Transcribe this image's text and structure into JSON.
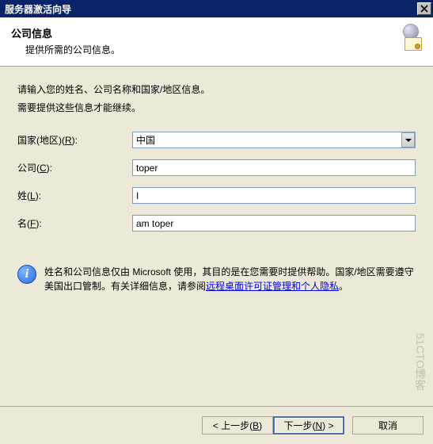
{
  "window": {
    "title": "服务器激活向导"
  },
  "header": {
    "title": "公司信息",
    "subtitle": "提供所需的公司信息。"
  },
  "intro": {
    "line1": "请输入您的姓名、公司名称和国家/地区信息。",
    "line2": "需要提供这些信息才能继续。"
  },
  "form": {
    "country": {
      "label_pre": "国家(地区)(",
      "label_key": "R",
      "label_post": "):",
      "value": "中国"
    },
    "company": {
      "label_pre": "公司(",
      "label_key": "C",
      "label_post": "):",
      "value": "toper"
    },
    "lastname": {
      "label_pre": "姓(",
      "label_key": "L",
      "label_post": "):",
      "value": "I"
    },
    "firstname": {
      "label_pre": "名(",
      "label_key": "F",
      "label_post": "):",
      "value": "am toper"
    }
  },
  "info": {
    "text_pre": "姓名和公司信息仅由 Microsoft 使用，其目的是在您需要时提供帮助。国家/地区需要遵守美国出口管制。有关详细信息，请参阅",
    "link": "远程桌面许可证管理和个人隐私",
    "text_post": "。"
  },
  "buttons": {
    "back_pre": "< 上一步(",
    "back_key": "B",
    "back_post": ")",
    "next_pre": "下一步(",
    "next_key": "N",
    "next_post": ") >",
    "cancel": "取消"
  },
  "watermark": "51CTO博客"
}
